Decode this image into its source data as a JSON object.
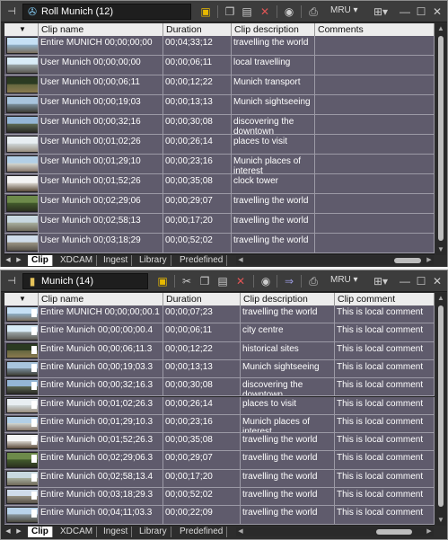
{
  "panel1": {
    "title": "Roll  Munich (12)",
    "toolbar_mru": "MRU",
    "columns": [
      "",
      "Clip name",
      "Duration",
      "Clip description",
      "Comments"
    ],
    "rows": [
      {
        "name": "Entire MUNICH 00;00;00;00",
        "duration": "00;04;33;12",
        "desc": "travelling the world",
        "comment": ""
      },
      {
        "name": "User Munich 00;00;00;00",
        "duration": "00;00;06;11",
        "desc": "local travelling",
        "comment": ""
      },
      {
        "name": "User Munich 00;00;06;11",
        "duration": "00;00;12;22",
        "desc": "Munich transport",
        "comment": ""
      },
      {
        "name": "User Munich 00;00;19;03",
        "duration": "00;00;13;13",
        "desc": "Munich sightseeing",
        "comment": ""
      },
      {
        "name": "User Munich 00;00;32;16",
        "duration": "00;00;30;08",
        "desc": "discovering the downtown",
        "comment": ""
      },
      {
        "name": "User Munich 00;01;02;26",
        "duration": "00;00;26;14",
        "desc": "places to visit",
        "comment": ""
      },
      {
        "name": "User Munich 00;01;29;10",
        "duration": "00;00;23;16",
        "desc": "Munich places of interest",
        "comment": ""
      },
      {
        "name": "User Munich 00;01;52;26",
        "duration": "00;00;35;08",
        "desc": "clock tower",
        "comment": ""
      },
      {
        "name": "User Munich 00;02;29;06",
        "duration": "00;00;29;07",
        "desc": "travelling the world",
        "comment": ""
      },
      {
        "name": "User Munich 00;02;58;13",
        "duration": "00;00;17;20",
        "desc": "travelling the world",
        "comment": ""
      },
      {
        "name": "User Munich 00;03;18;29",
        "duration": "00;00;52;02",
        "desc": "travelling the world",
        "comment": ""
      }
    ],
    "tabs": [
      "Clip",
      "XDCAM",
      "Ingest",
      "Library",
      "Predefined"
    ]
  },
  "panel2": {
    "title": "Munich (14)",
    "toolbar_mru": "MRU",
    "columns": [
      "",
      "Clip name",
      "Duration",
      "Clip description",
      "Clip comment"
    ],
    "rows": [
      {
        "name": "Entire MUNICH 00;00;00;00.1",
        "duration": "00;00;07;23",
        "desc": "travelling the world",
        "comment": "This is local comment"
      },
      {
        "name": "Entire Munich 00;00;00;00.4",
        "duration": "00;00;06;11",
        "desc": "city centre",
        "comment": "This is local comment"
      },
      {
        "name": "Entire Munich 00;00;06;11.3",
        "duration": "00;00;12;22",
        "desc": "historical sites",
        "comment": "This is local comment"
      },
      {
        "name": "Entire Munich 00;00;19;03.3",
        "duration": "00;00;13;13",
        "desc": "Munich sightseeing",
        "comment": "This is local comment"
      },
      {
        "name": "Entire Munich 00;00;32;16.3",
        "duration": "00;00;30;08",
        "desc": "discovering the downtown",
        "comment": "This is local comment"
      },
      {
        "name": "Entire Munich 00;01;02;26.3",
        "duration": "00;00;26;14",
        "desc": "places to visit",
        "comment": "This is local comment"
      },
      {
        "name": "Entire Munich 00;01;29;10.3",
        "duration": "00;00;23;16",
        "desc": "Munich places of interest",
        "comment": "This is local comment"
      },
      {
        "name": "Entire Munich 00;01;52;26.3",
        "duration": "00;00;35;08",
        "desc": "travelling the world",
        "comment": "This is local comment"
      },
      {
        "name": "Entire Munich 00;02;29;06.3",
        "duration": "00;00;29;07",
        "desc": "travelling the world",
        "comment": "This is local comment"
      },
      {
        "name": "Entire Munich 00;02;58;13.4",
        "duration": "00;00;17;20",
        "desc": "travelling the world",
        "comment": "This is local comment"
      },
      {
        "name": "Entire Munich 00;03;18;29.3",
        "duration": "00;00;52;02",
        "desc": "travelling the world",
        "comment": "This is local comment"
      },
      {
        "name": "Entire Munich 00;04;11;03.3",
        "duration": "00;00;22;09",
        "desc": "travelling the world",
        "comment": "This is local comment"
      }
    ],
    "tabs": [
      "Clip",
      "XDCAM",
      "Ingest",
      "Library",
      "Predefined"
    ]
  },
  "icons": [
    "pin-icon",
    "roll-icon",
    "bin-icon",
    "folder-icon",
    "cut-icon",
    "copy-icon",
    "paste-icon",
    "delete-icon",
    "eye-icon",
    "print-icon",
    "settings-icon",
    "minimize-icon",
    "maximize-icon",
    "close-icon"
  ],
  "colors": {
    "row_bg": "#5f5b6c",
    "panel_bg": "#2d2d2d",
    "delete_red": "#e05555",
    "folder_yellow": "#e6b800"
  }
}
